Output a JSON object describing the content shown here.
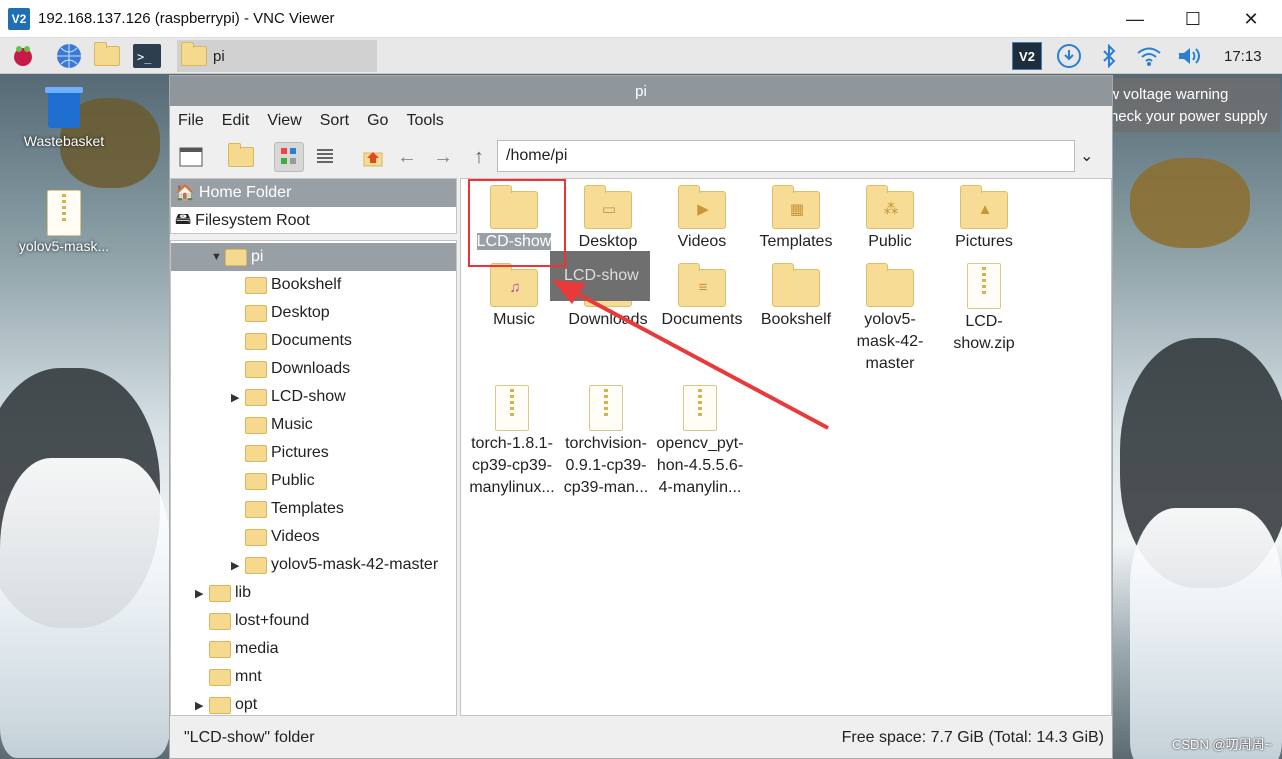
{
  "vnc": {
    "title": "192.168.137.126 (raspberrypi) - VNC Viewer",
    "logo": "V2",
    "minimize": "—",
    "maximize": "☐",
    "close": "✕"
  },
  "taskbar": {
    "task_label": "pi",
    "clock": "17:13"
  },
  "desktop": {
    "wastebasket": "Wastebasket",
    "zip_file": "yolov5-mask..."
  },
  "warning": {
    "line1": "Low voltage warning",
    "line2": "Please check your power supply"
  },
  "fm": {
    "title": "pi",
    "menu": [
      "File",
      "Edit",
      "View",
      "Sort",
      "Go",
      "Tools"
    ],
    "path": "/home/pi",
    "places": [
      "Home Folder",
      "Filesystem Root"
    ],
    "tree": {
      "root": "pi",
      "children": [
        "Bookshelf",
        "Desktop",
        "Documents",
        "Downloads",
        "LCD-show",
        "Music",
        "Pictures",
        "Public",
        "Templates",
        "Videos",
        "yolov5-mask-42-master"
      ],
      "siblings": [
        "lib",
        "lost+found",
        "media",
        "mnt",
        "opt"
      ]
    },
    "items": [
      {
        "label": "LCD-show"
      },
      {
        "label": "Desktop"
      },
      {
        "label": "Videos"
      },
      {
        "label": "Templates"
      },
      {
        "label": "Public"
      },
      {
        "label": "Pictures"
      },
      {
        "label": "Music"
      },
      {
        "label": "Downloads"
      },
      {
        "label": "Documents"
      },
      {
        "label": "Bookshelf"
      },
      {
        "label": "yolov5-\nmask-42-\nmaster"
      },
      {
        "label": "LCD-\nshow.zip"
      },
      {
        "label": "torch-1.8.1-\ncp39-cp39-\nmanylinux..."
      },
      {
        "label": "torchvision-\n0.9.1-cp39-\ncp39-man..."
      },
      {
        "label": "opencv_pyt-\nhon-4.5.5.6-\n4-manylin..."
      }
    ],
    "tooltip": "LCD-show",
    "status_left": "\"LCD-show\" folder",
    "status_right": "Free space: 7.7 GiB (Total: 14.3 GiB)"
  },
  "watermark": "CSDN @叨周周~"
}
